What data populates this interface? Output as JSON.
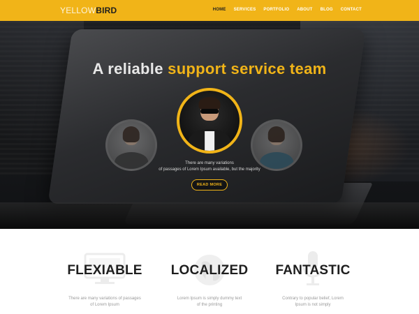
{
  "header": {
    "logo_light": "YELLOW",
    "logo_bold": "BIRD",
    "nav": [
      {
        "label": "HOME",
        "active": true
      },
      {
        "label": "SERVICES",
        "active": false
      },
      {
        "label": "PORTFOLIO",
        "active": false
      },
      {
        "label": "ABOUT",
        "active": false
      },
      {
        "label": "BLOG",
        "active": false
      },
      {
        "label": "CONTACT",
        "active": false
      }
    ]
  },
  "hero": {
    "title_plain": "A reliable ",
    "title_accent": "support service team",
    "text_line1": "There are many variations",
    "text_line2": "of passages of Lorem Ipsum available, but the majority",
    "button_label": "READ MORE"
  },
  "features": [
    {
      "title": "FLEXIABLE",
      "icon": "monitor-icon",
      "line1": "There are many variations of passages",
      "line2": "of Lorem Ipsum"
    },
    {
      "title": "LOCALIZED",
      "icon": "globe-icon",
      "line1": "Lorem Ipsum is simply dummy text",
      "line2": "of the printing"
    },
    {
      "title": "FANTASTIC",
      "icon": "microphone-icon",
      "line1": "Contrary to popular belief, Lorem",
      "line2": "Ipsum is not simply"
    }
  ],
  "colors": {
    "accent": "#f1b418",
    "dark": "#1e1e1e"
  }
}
